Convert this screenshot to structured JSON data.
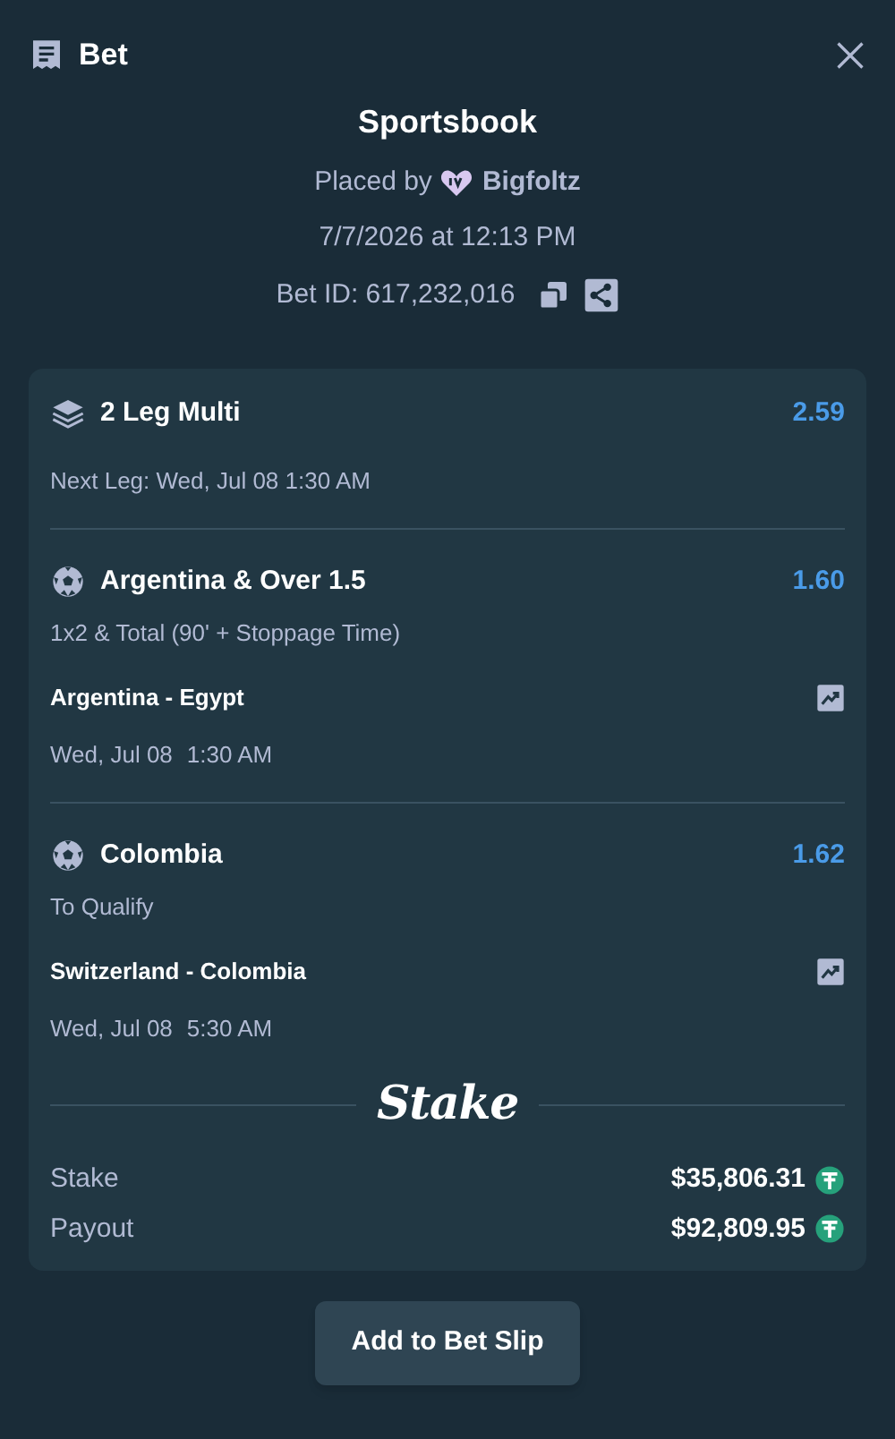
{
  "header": {
    "title": "Bet"
  },
  "summary": {
    "title": "Sportsbook",
    "placed_by_label": "Placed by",
    "user": "Bigfoltz",
    "date": "7/7/2026 at 12:13 PM",
    "bet_id": "Bet ID: 617,232,016"
  },
  "multi": {
    "title": "2 Leg Multi",
    "odds": "2.59",
    "next_leg": "Next Leg: Wed, Jul 08 1:30 AM"
  },
  "legs": [
    {
      "selection": "Argentina & Over 1.5",
      "odds": "1.60",
      "market": "1x2 & Total (90' + Stoppage Time)",
      "event": "Argentina - Egypt",
      "date": "Wed, Jul 08",
      "time": "1:30 AM"
    },
    {
      "selection": "Colombia",
      "odds": "1.62",
      "market": "To Qualify",
      "event": "Switzerland - Colombia",
      "date": "Wed, Jul 08",
      "time": "5:30 AM"
    }
  ],
  "brand": "Stake",
  "totals": [
    {
      "label": "Stake",
      "amount": "$35,806.31"
    },
    {
      "label": "Payout",
      "amount": "$92,809.95"
    }
  ],
  "button": "Add to Bet Slip"
}
